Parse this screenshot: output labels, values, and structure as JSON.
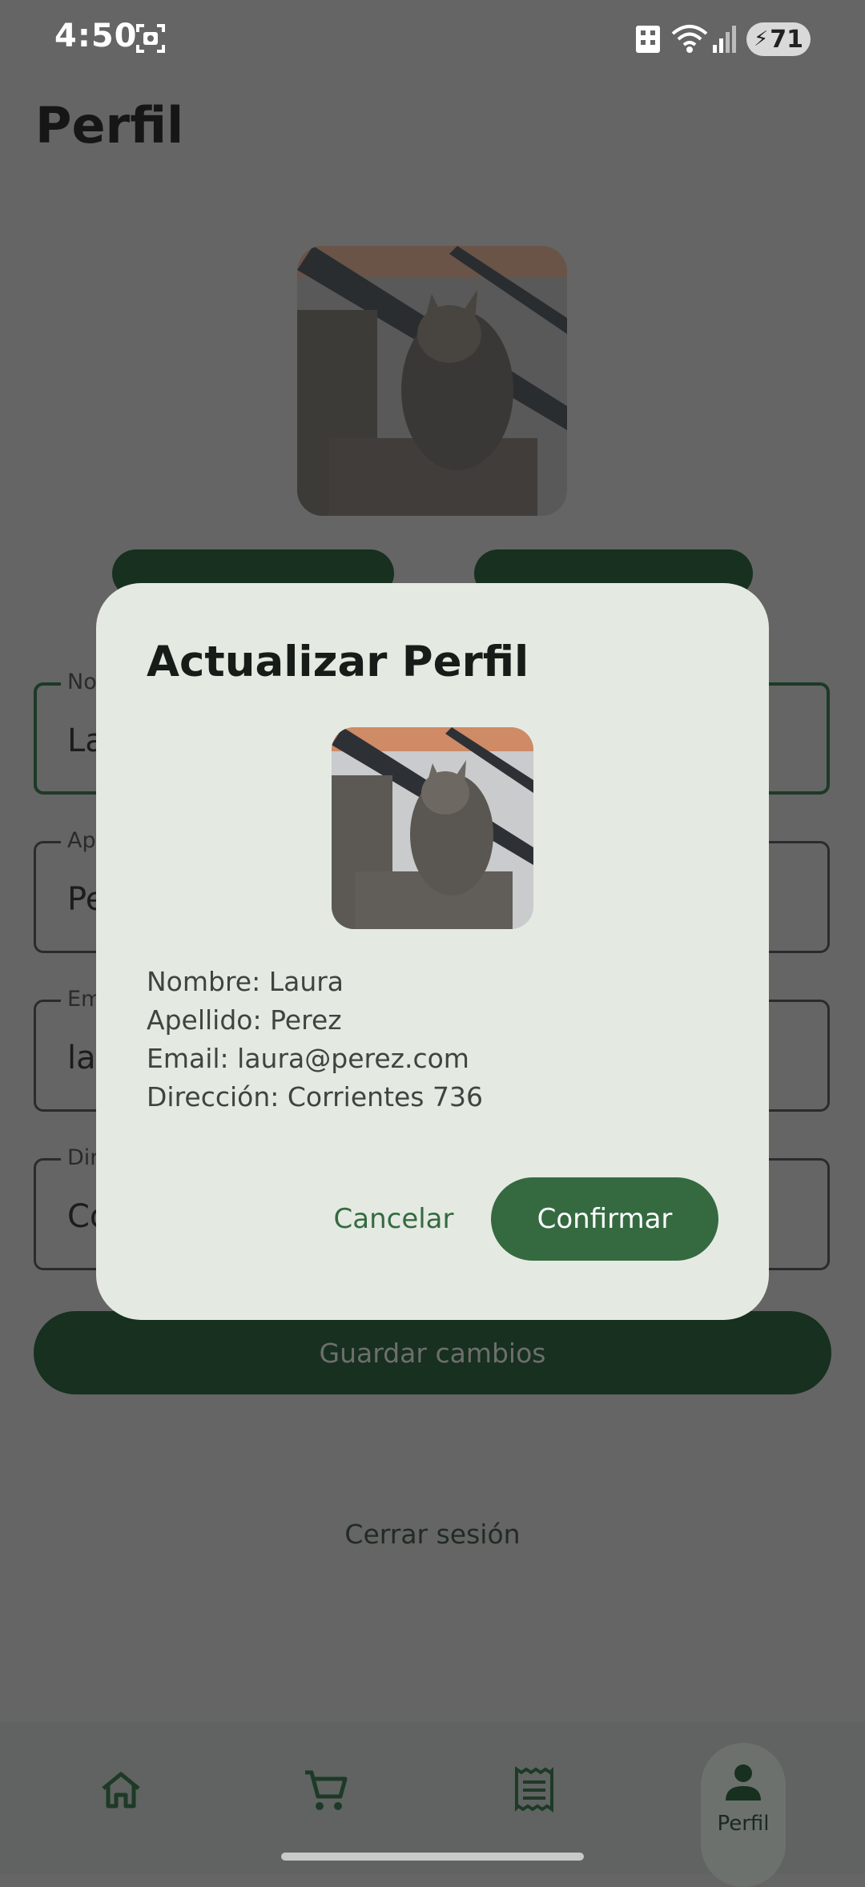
{
  "status_bar": {
    "time": "4:50",
    "battery": "71"
  },
  "page": {
    "title": "Perfil"
  },
  "form": {
    "fields": [
      {
        "label": "No",
        "value": "La"
      },
      {
        "label": "Ap",
        "value": "Pe"
      },
      {
        "label": "Em",
        "value": "la"
      },
      {
        "label": "Dir",
        "value": "Co"
      }
    ],
    "save_label": "Guardar cambios",
    "logout_label": "Cerrar sesión"
  },
  "dialog": {
    "title": "Actualizar Perfil",
    "lines": [
      "Nombre: Laura",
      "Apellido: Perez",
      "Email: laura@perez.com",
      "Dirección: Corrientes 736"
    ],
    "cancel_label": "Cancelar",
    "confirm_label": "Confirmar"
  },
  "nav": {
    "items": [
      {
        "icon": "home-icon"
      },
      {
        "icon": "cart-icon"
      },
      {
        "icon": "receipt-icon"
      },
      {
        "icon": "person-icon",
        "label": "Perfil"
      }
    ]
  },
  "colors": {
    "accent": "#356a41",
    "dark_green": "#17301f",
    "dialog_bg": "#e4eae2",
    "scrim": "#656565"
  }
}
